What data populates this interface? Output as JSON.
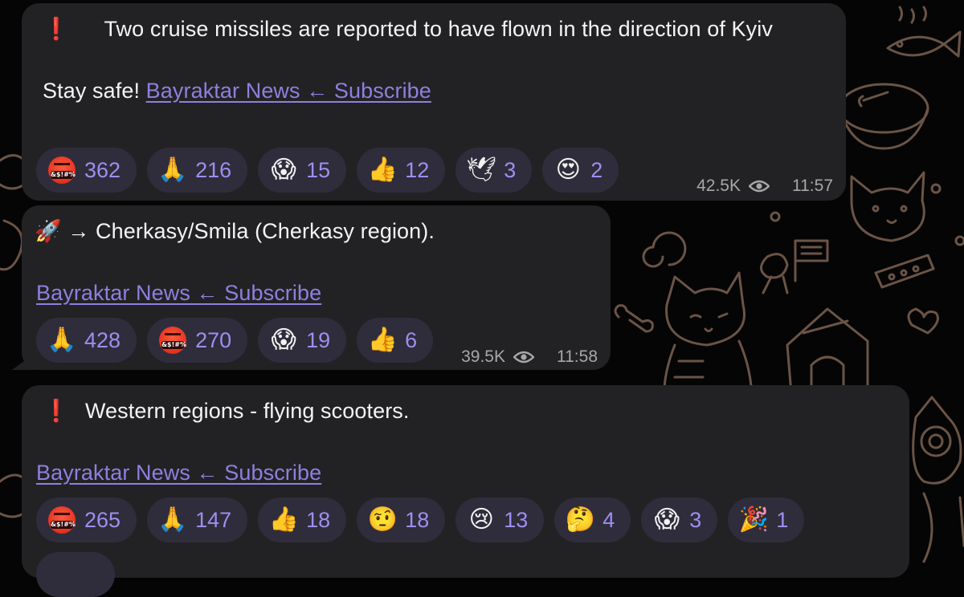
{
  "messages": [
    {
      "exclaim": "❗",
      "text": "Two cruise missiles are reported to have flown in the direction of Kyiv",
      "line2_prefix": "Stay safe! ",
      "link": "Bayraktar News ← Subscribe",
      "reactions": [
        {
          "icon": "enraged-face-icon",
          "emoji": "🤬",
          "count": "362"
        },
        {
          "icon": "folded-hands-icon",
          "emoji": "🙏",
          "count": "216"
        },
        {
          "icon": "screaming-face-icon",
          "emoji": "😱",
          "count": "15"
        },
        {
          "icon": "thumbs-up-icon",
          "emoji": "👍",
          "count": "12"
        },
        {
          "icon": "dove-icon",
          "emoji": "🕊",
          "count": "3"
        },
        {
          "icon": "heart-eyes-icon",
          "emoji": "😍",
          "count": "2"
        }
      ],
      "views": "42.5K",
      "time": "11:57"
    },
    {
      "prefix": "🚀 → ",
      "text": "Cherkasy/Smila (Cherkasy region).",
      "link": "Bayraktar News ← Subscribe",
      "reactions": [
        {
          "icon": "folded-hands-icon",
          "emoji": "🙏",
          "count": "428"
        },
        {
          "icon": "enraged-face-icon",
          "emoji": "🤬",
          "count": "270"
        },
        {
          "icon": "screaming-face-icon",
          "emoji": "😱",
          "count": "19"
        },
        {
          "icon": "thumbs-up-icon",
          "emoji": "👍",
          "count": "6"
        }
      ],
      "views": "39.5K",
      "time": "11:58"
    },
    {
      "exclaim": "❗",
      "text": "Western regions - flying scooters.",
      "link": "Bayraktar News ← Subscribe",
      "reactions": [
        {
          "icon": "enraged-face-icon",
          "emoji": "🤬",
          "count": "265"
        },
        {
          "icon": "folded-hands-icon",
          "emoji": "🙏",
          "count": "147"
        },
        {
          "icon": "thumbs-up-icon",
          "emoji": "👍",
          "count": "18"
        },
        {
          "icon": "raised-eyebrow-face-icon",
          "emoji": "🤨",
          "count": "18"
        },
        {
          "icon": "crying-face-icon",
          "emoji": "😢",
          "count": "13"
        },
        {
          "icon": "thinking-face-icon",
          "emoji": "🤔",
          "count": "4"
        },
        {
          "icon": "screaming-face-icon",
          "emoji": "😱",
          "count": "3"
        },
        {
          "icon": "party-popper-icon",
          "emoji": "🎉",
          "count": "1"
        }
      ]
    }
  ],
  "colors": {
    "bubble": "#222224",
    "link": "#8f7fe0",
    "reaction_chip": "#2f2d3b",
    "reaction_count": "#9d8ff0",
    "meta": "#a7a7a7",
    "doodle": "#6b5446"
  }
}
